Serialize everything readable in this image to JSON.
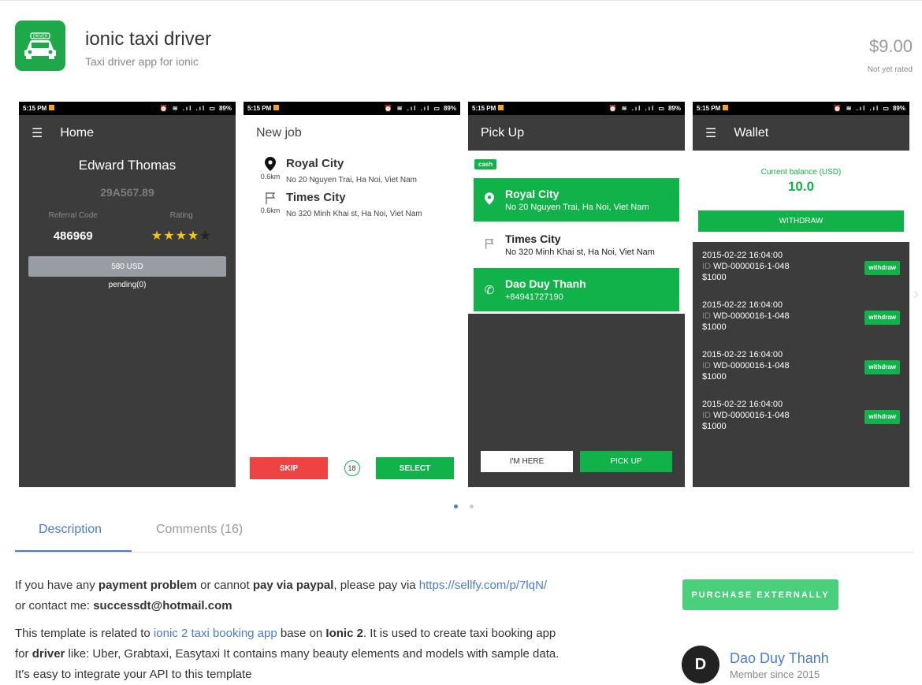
{
  "app": {
    "title": "ionic taxi driver",
    "subtitle": "Taxi driver app for ionic",
    "price": "$9.00",
    "rating": "Not yet rated",
    "icon_badge": "DRIVER"
  },
  "status": {
    "time": "5:15 PM",
    "battery": "89%"
  },
  "screen1": {
    "title": "Home",
    "name": "Edward Thomas",
    "plate": "29A567.89",
    "referral_label": "Referral Code",
    "rating_label": "Rating",
    "referral_code": "486969",
    "rating_value": 4,
    "rating_max": 5,
    "balance_button": "580 USD",
    "pending": "pending(0)"
  },
  "screen2": {
    "title": "New job",
    "jobs": [
      {
        "distance": "0.6km",
        "place": "Royal City",
        "address": "No 20 Nguyen Trai, Ha Noi, Viet Nam"
      },
      {
        "distance": "0.6km",
        "place": "Times City",
        "address": "No 320 Minh Khai st, Ha Noi, Viet Nam"
      }
    ],
    "skip": "SKIP",
    "counter": "18",
    "select": "SELECT"
  },
  "screen3": {
    "title": "Pick Up",
    "tag": "cash",
    "pickup": {
      "place": "Royal City",
      "address": "No 20 Nguyen Trai, Ha Noi, Viet Nam"
    },
    "dropoff": {
      "place": "Times City",
      "address": "No 320 Minh Khai st, Ha Noi, Viet Nam"
    },
    "contact": {
      "name": "Dao Duy Thanh",
      "phone": "+84941727190"
    },
    "im_here": "I'M HERE",
    "pick_up": "PICK UP"
  },
  "screen4": {
    "title": "Wallet",
    "balance_label": "Current balance (USD)",
    "balance": "10.0",
    "withdraw": "WITHDRAW",
    "transactions": [
      {
        "date": "2015-02-22 16:04:00",
        "id_label": "ID",
        "id": "WD-0000016-1-048",
        "amount": "$1000",
        "tag": "withdraw"
      },
      {
        "date": "2015-02-22 16:04:00",
        "id_label": "ID",
        "id": "WD-0000016-1-048",
        "amount": "$1000",
        "tag": "withdraw"
      },
      {
        "date": "2015-02-22 16:04:00",
        "id_label": "ID",
        "id": "WD-0000016-1-048",
        "amount": "$1000",
        "tag": "withdraw"
      },
      {
        "date": "2015-02-22 16:04:00",
        "id_label": "ID",
        "id": "WD-0000016-1-048",
        "amount": "$1000",
        "tag": "withdraw"
      }
    ]
  },
  "carousel": {
    "active_index": 0,
    "count": 2
  },
  "tabs": {
    "description": "Description",
    "comments": "Comments (16)"
  },
  "description": {
    "p1_a": "If you have any ",
    "p1_b": "payment problem",
    "p1_c": " or cannot ",
    "p1_d": "pay via paypal",
    "p1_e": ", please pay via ",
    "p1_link": "https://sellfy.com/p/7lqN/",
    "p1_f": "or contact me: ",
    "p1_email": "successdt@hotmail.com",
    "p2_a": "This template is related to ",
    "p2_link": "ionic 2 taxi booking app",
    "p2_b": " base on ",
    "p2_c": "Ionic 2",
    "p2_d": ". It is used to create taxi booking app",
    "p2_e": "for ",
    "p2_f": "driver",
    "p2_g": " like: Uber, Grabtaxi, Easytaxi It contains many beauty elements and models with sample data.",
    "p2_h": "It's easy to integrate your API to this template"
  },
  "sidebar": {
    "purchase": "PURCHASE EXTERNALLY",
    "avatar_letter": "D",
    "author": "Dao Duy Thanh",
    "member": "Member since 2015"
  },
  "colors": {
    "accent": "#4a7bd0",
    "green": "#12b24a",
    "red": "#ef4242",
    "dark": "#3c3c3c"
  }
}
